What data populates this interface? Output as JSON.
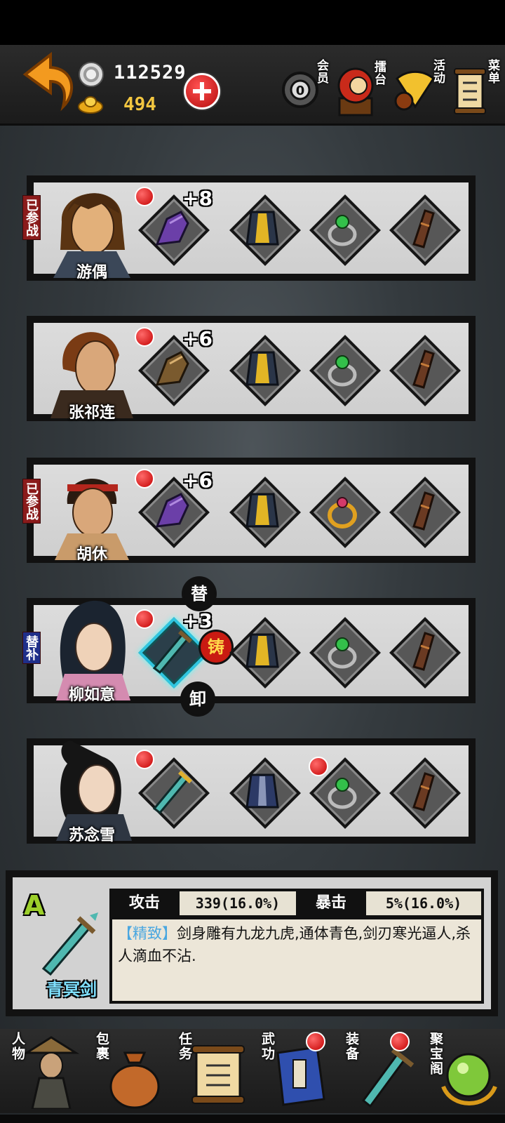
{
  "header": {
    "silver": "112529",
    "gold": "494",
    "menu": [
      {
        "label": "会员"
      },
      {
        "label": "擂台"
      },
      {
        "label": "活动"
      },
      {
        "label": "菜单"
      }
    ]
  },
  "heroes": [
    {
      "name": "游偶",
      "tag": "已参战",
      "weapon_enhance": "+8"
    },
    {
      "name": "张祁连",
      "tag": "",
      "weapon_enhance": "+6"
    },
    {
      "name": "胡休",
      "tag": "已参战",
      "weapon_enhance": "+6"
    },
    {
      "name": "柳如意",
      "tag": "替补",
      "weapon_enhance": "+3",
      "actions": {
        "replace": "替",
        "forge": "铸",
        "unequip": "卸"
      }
    },
    {
      "name": "苏念雪",
      "tag": "",
      "weapon_enhance": ""
    }
  ],
  "detail": {
    "grade": "A",
    "item_name": "青冥剑",
    "stat1_label": "攻击",
    "stat1_value": "339(16.0%)",
    "stat2_label": "暴击",
    "stat2_value": "5%(16.0%)",
    "quality": "【精致】",
    "description": "剑身雕有九龙九虎,通体青色,剑刃寒光逼人,杀人滴血不沾."
  },
  "bottom_nav": [
    {
      "label": "人物"
    },
    {
      "label": "包裹"
    },
    {
      "label": "任务"
    },
    {
      "label": "武功"
    },
    {
      "label": "装备"
    },
    {
      "label": "聚宝阁"
    }
  ],
  "colors": {
    "accent_red": "#c30000",
    "gold_text": "#f2c640",
    "selected_cyan": "#2fc6e0",
    "grade_green": "#9ccf2b"
  }
}
